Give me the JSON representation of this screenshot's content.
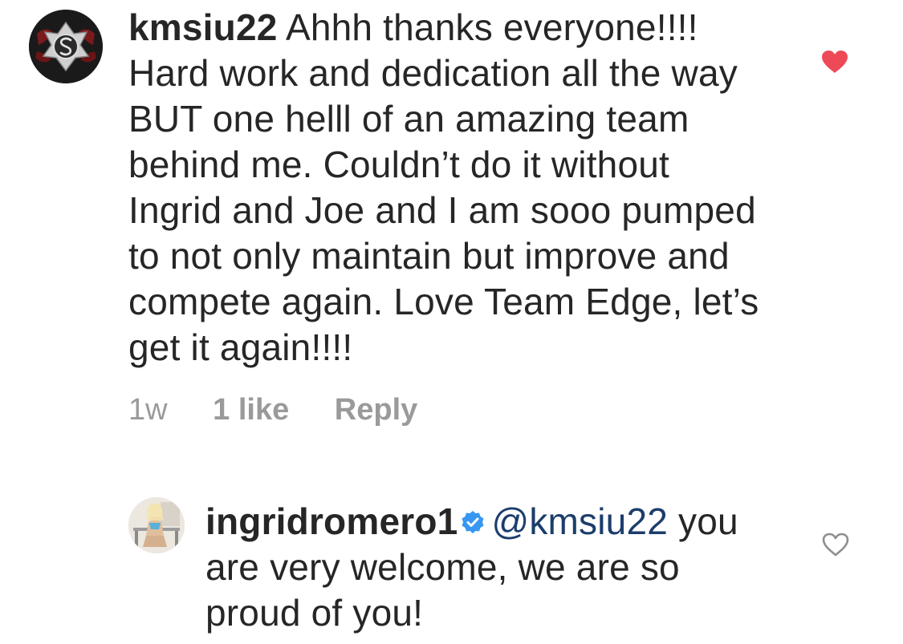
{
  "comments": [
    {
      "username": "kmsiu22",
      "text": " Ahhh thanks everyone!!!! Hard work and dedication all the way BUT one helll of an amazing team behind me. Couldn’t do it without Ingrid and Joe and I am sooo pumped to not only maintain but improve and compete again. Love Team Edge, let’s get it again!!!!",
      "time": "1w",
      "likes": "1 like",
      "reply_label": "Reply",
      "liked": true,
      "heart_color": "#ed4956",
      "avatar_icon": "fire-department-s-emblem"
    },
    {
      "username": "ingridromero1",
      "verified": true,
      "verified_color": "#3897f0",
      "mention": "@kmsiu22",
      "text": " you are very welcome, we are so proud of you!",
      "liked": false,
      "heart_color": "#8e8e8e",
      "avatar_icon": "user-photo"
    }
  ]
}
